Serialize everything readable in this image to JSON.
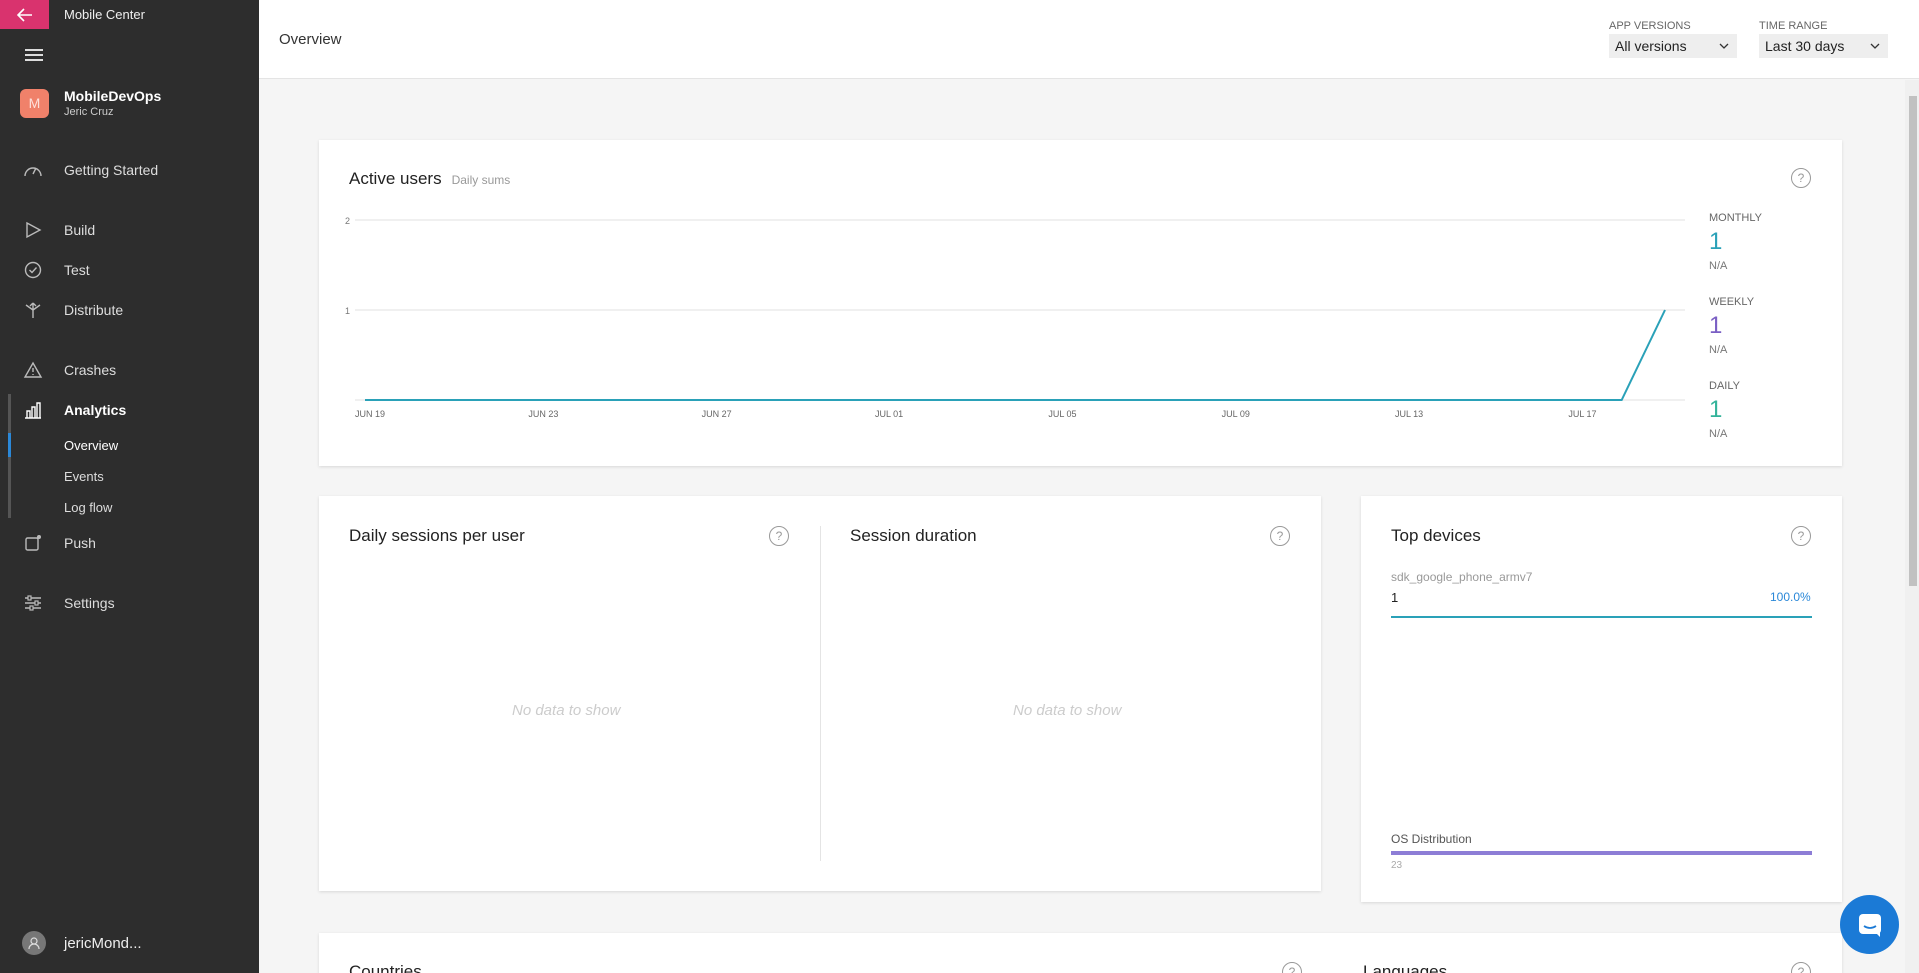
{
  "app": {
    "title": "Mobile Center"
  },
  "org": {
    "initial": "M",
    "name": "MobileDevOps",
    "user": "Jeric Cruz"
  },
  "nav": {
    "getting_started": "Getting Started",
    "build": "Build",
    "test": "Test",
    "distribute": "Distribute",
    "crashes": "Crashes",
    "analytics": "Analytics",
    "overview": "Overview",
    "events": "Events",
    "log_flow": "Log flow",
    "push": "Push",
    "settings": "Settings"
  },
  "footer": {
    "username": "jericMond..."
  },
  "header": {
    "title": "Overview",
    "app_versions_label": "APP VERSIONS",
    "app_versions_value": "All versions",
    "time_range_label": "TIME RANGE",
    "time_range_value": "Last 30 days"
  },
  "active_users": {
    "title": "Active users",
    "subtitle": "Daily sums",
    "monthly_label": "MONTHLY",
    "monthly_value": "1",
    "monthly_change": "N/A",
    "weekly_label": "WEEKLY",
    "weekly_value": "1",
    "weekly_change": "N/A",
    "daily_label": "DAILY",
    "daily_value": "1",
    "daily_change": "N/A"
  },
  "chart_data": {
    "type": "line",
    "title": "Active users",
    "subtitle": "Daily sums",
    "x_ticks": [
      "JUN 19",
      "JUN 23",
      "JUN 27",
      "JUL 01",
      "JUL 05",
      "JUL 09",
      "JUL 13",
      "JUL 17"
    ],
    "y_ticks": [
      "1",
      "2"
    ],
    "ylim": [
      0,
      2
    ],
    "series": [
      {
        "color": "#2aa1b8",
        "x": [
          "JUN 19",
          "JUN 20",
          "JUN 21",
          "JUN 22",
          "JUN 23",
          "JUN 24",
          "JUN 25",
          "JUN 26",
          "JUN 27",
          "JUN 28",
          "JUN 29",
          "JUN 30",
          "JUL 01",
          "JUL 02",
          "JUL 03",
          "JUL 04",
          "JUL 05",
          "JUL 06",
          "JUL 07",
          "JUL 08",
          "JUL 09",
          "JUL 10",
          "JUL 11",
          "JUL 12",
          "JUL 13",
          "JUL 14",
          "JUL 15",
          "JUL 16",
          "JUL 17",
          "JUL 18",
          "JUL 19"
        ],
        "values": [
          0,
          0,
          0,
          0,
          0,
          0,
          0,
          0,
          0,
          0,
          0,
          0,
          0,
          0,
          0,
          0,
          0,
          0,
          0,
          0,
          0,
          0,
          0,
          0,
          0,
          0,
          0,
          0,
          0,
          0,
          1
        ]
      }
    ]
  },
  "sessions": {
    "title": "Daily sessions per user",
    "empty": "No data to show"
  },
  "duration": {
    "title": "Session duration",
    "empty": "No data to show"
  },
  "top_devices": {
    "title": "Top devices",
    "device_name": "sdk_google_phone_armv7",
    "device_count": "1",
    "device_percent": "100.0%",
    "device_share": 1.0,
    "os_label": "OS Distribution",
    "os_value": "23"
  },
  "countries": {
    "title": "Countries"
  },
  "languages": {
    "title": "Languages"
  },
  "help": "?",
  "colors": {
    "accent": "#d9336e",
    "monthly": "#2aa1b8",
    "weekly": "#7a5fc4",
    "daily": "#33b39a",
    "os_bar": "#8d7dd6"
  }
}
